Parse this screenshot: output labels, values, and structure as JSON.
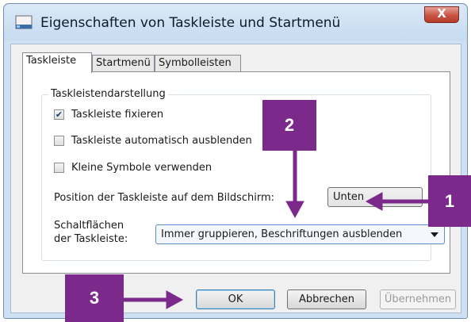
{
  "window": {
    "title": "Eigenschaften von Taskleiste und Startmenü",
    "close_label": "X"
  },
  "tabs": [
    {
      "label": "Taskleiste",
      "active": true
    },
    {
      "label": "Startmenü",
      "active": false
    },
    {
      "label": "Symbolleisten",
      "active": false
    }
  ],
  "group": {
    "legend": "Taskleistendarstellung",
    "checkboxes": [
      {
        "label": "Taskleiste fixieren",
        "checked": true
      },
      {
        "label": "Taskleiste automatisch ausblenden",
        "checked": false
      },
      {
        "label": "Kleine Symbole verwenden",
        "checked": false
      }
    ],
    "position_label": "Position der Taskleiste auf dem Bildschirm:",
    "position_value": "Unten",
    "buttons_label_line1": "Schaltflächen",
    "buttons_label_line2": "der Taskleiste:",
    "buttons_value": "Immer gruppieren, Beschriftungen ausblenden"
  },
  "footer": {
    "ok": "OK",
    "cancel": "Abbrechen",
    "apply": "Übernehmen"
  },
  "annotations": {
    "badge_1": "1",
    "badge_2": "2",
    "badge_3": "3",
    "color": "#7b2a8b"
  }
}
